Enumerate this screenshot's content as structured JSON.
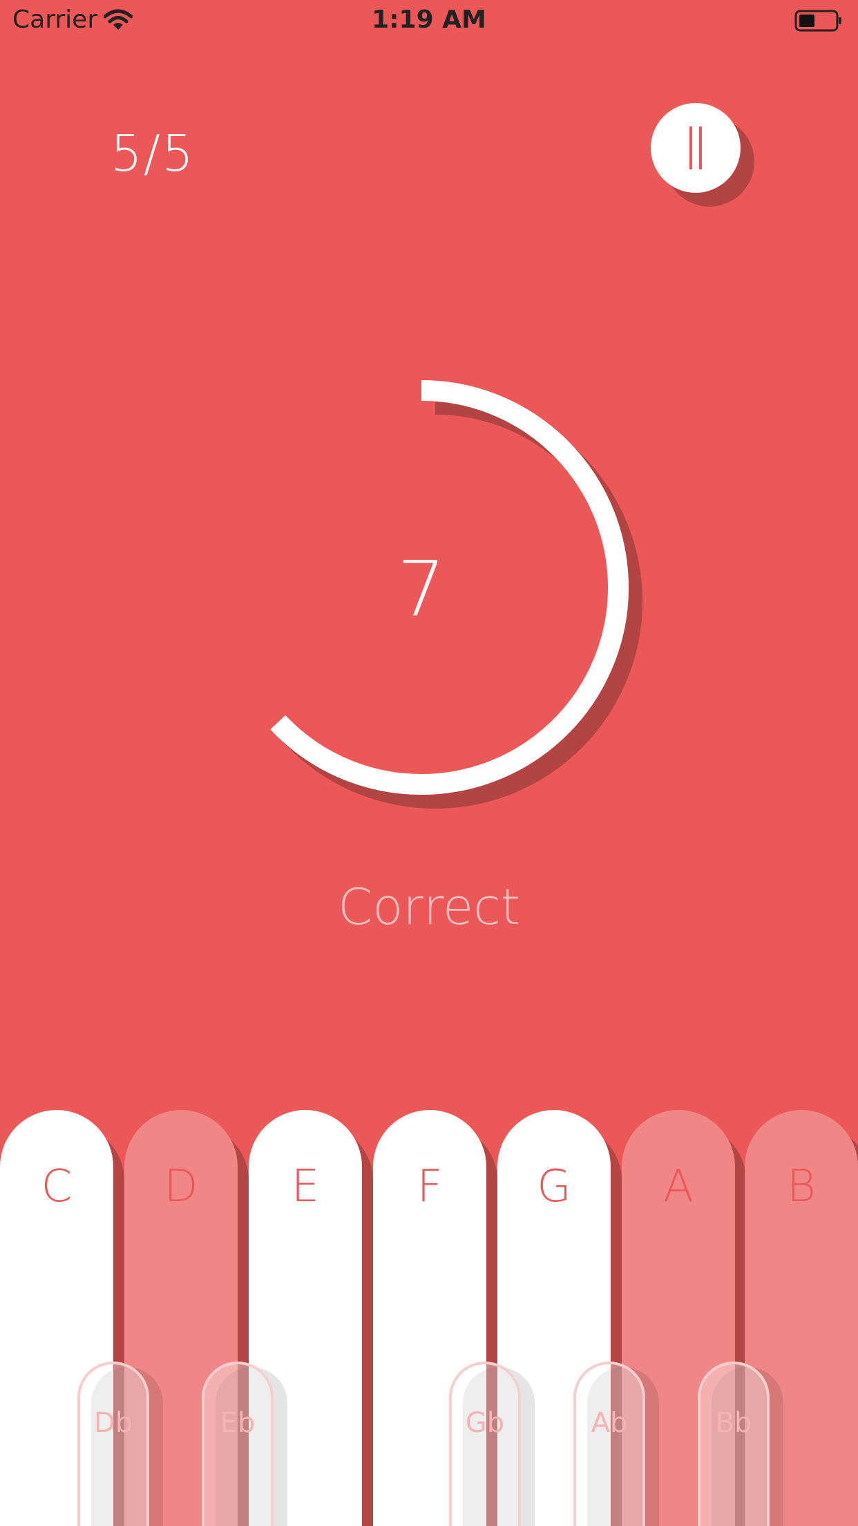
{
  "status_bar": {
    "carrier": "Carrier",
    "time": "1:19 AM"
  },
  "game": {
    "progress": "5/5",
    "countdown": "7",
    "result": "Correct",
    "countdown_fraction_remaining": 0.63
  },
  "pause_button": {
    "icon": "pause-icon"
  },
  "keyboard": {
    "white_keys": [
      {
        "label": "C",
        "state": "active"
      },
      {
        "label": "D",
        "state": "inactive"
      },
      {
        "label": "E",
        "state": "active"
      },
      {
        "label": "F",
        "state": "active"
      },
      {
        "label": "G",
        "state": "active"
      },
      {
        "label": "A",
        "state": "inactive"
      },
      {
        "label": "B",
        "state": "inactive"
      }
    ],
    "black_keys": [
      {
        "label": "Db"
      },
      {
        "label": "Eb"
      },
      {
        "label": "Gb"
      },
      {
        "label": "Ab"
      },
      {
        "label": "Bb"
      }
    ]
  },
  "colors": {
    "background": "#ec5757",
    "accent_white": "#ffffff",
    "shadow": "#b34444",
    "inactive_key": "#f08686"
  }
}
